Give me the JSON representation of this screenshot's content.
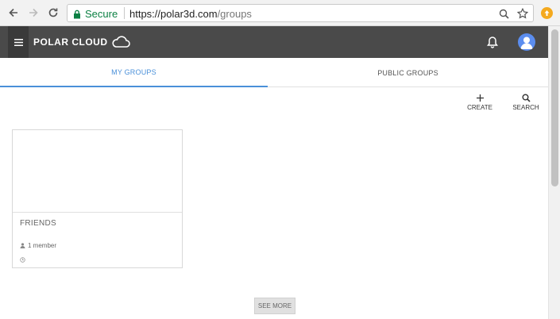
{
  "browser": {
    "secure_label": "Secure",
    "url_host": "https://polar3d.com",
    "url_path": "/groups"
  },
  "app": {
    "brand": "POLAR CLOUD"
  },
  "tabs": [
    {
      "label": "MY GROUPS",
      "active": true
    },
    {
      "label": "PUBLIC GROUPS",
      "active": false
    }
  ],
  "actions": {
    "create_label": "CREATE",
    "search_label": "SEARCH"
  },
  "groups": [
    {
      "title": "FRIENDS",
      "members": "1 member"
    }
  ],
  "see_more_label": "SEE MORE",
  "colors": {
    "appbar": "#4a4a4a",
    "accent": "#4a90d9",
    "secure": "#0b8043"
  }
}
